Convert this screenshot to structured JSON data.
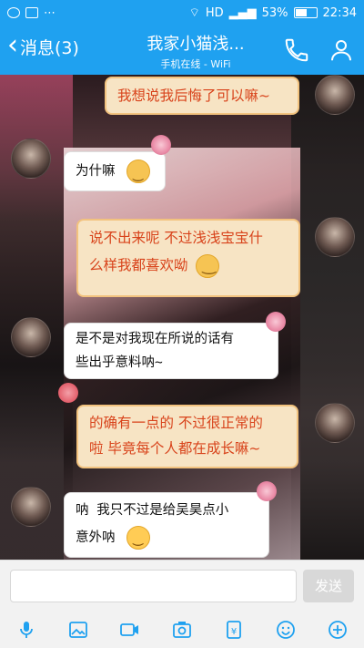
{
  "status": {
    "left_icons": [
      "wechat-icon",
      "image-icon",
      "more-icon"
    ],
    "right": {
      "network": "HD",
      "battery_pct": "53%",
      "time": "22:34"
    }
  },
  "header": {
    "back_label": "消息(3)",
    "title": "我家小猫浅...",
    "subtitle": "手机在线 - WiFi",
    "icons": [
      "phone-icon",
      "person-icon"
    ]
  },
  "messages": [
    {
      "side": "me",
      "text": "我想说我后悔了可以嘛~"
    },
    {
      "side": "them",
      "text": "为什嘛",
      "emoji": "smile-emoji"
    },
    {
      "side": "me",
      "line1": "说不出来呢 不过浅浅宝宝什",
      "line2": "么样我都喜欢呦",
      "emoji": "smile-emoji"
    },
    {
      "side": "them",
      "line1": "是不是对我现在所说的话有",
      "line2": "些出乎意料呐~"
    },
    {
      "side": "me",
      "line1": "的确有一点的 不过很正常的",
      "line2": "啦 毕竟每个人都在成长嘛~"
    },
    {
      "side": "them",
      "line1": "呐 我只不过是给吴昊点小",
      "line2": "意外呐",
      "emoji": "cry-emoji"
    }
  ],
  "input": {
    "value": "",
    "send_label": "发送"
  },
  "toolbar": [
    "mic-icon",
    "image-icon",
    "video-icon",
    "camera-icon",
    "red-packet-icon",
    "emoji-icon",
    "plus-icon"
  ],
  "colors": {
    "accent": "#1fa1f0",
    "me_bubble": "#f7e4c4",
    "me_text": "#d8431b"
  }
}
